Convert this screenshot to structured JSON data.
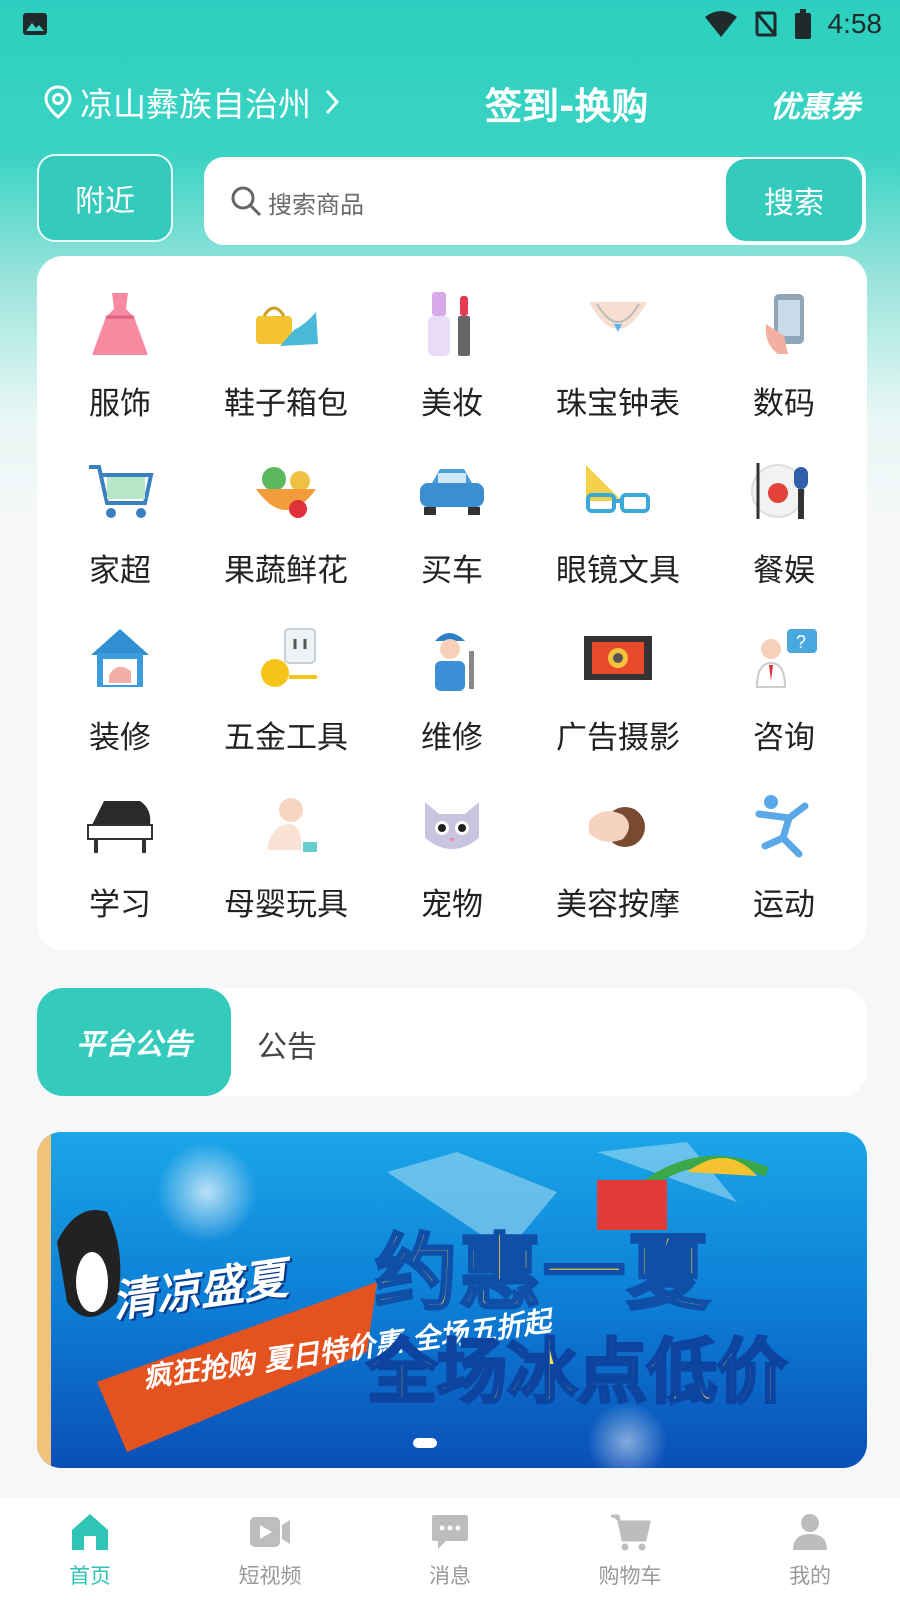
{
  "status_bar": {
    "time": "4:58"
  },
  "header": {
    "location": "凉山彝族自治州",
    "title": "签到-换购",
    "coupon": "优惠券"
  },
  "search": {
    "nearby_label": "附近",
    "placeholder": "搜索商品",
    "button_label": "搜索"
  },
  "categories": [
    {
      "label": "服饰",
      "icon": "dress-icon"
    },
    {
      "label": "鞋子箱包",
      "icon": "shoe-bag-icon"
    },
    {
      "label": "美妆",
      "icon": "makeup-icon"
    },
    {
      "label": "珠宝钟表",
      "icon": "necklace-icon"
    },
    {
      "label": "数码",
      "icon": "phone-icon"
    },
    {
      "label": "家超",
      "icon": "cart-icon"
    },
    {
      "label": "果蔬鲜花",
      "icon": "fruit-bowl-icon"
    },
    {
      "label": "买车",
      "icon": "car-icon"
    },
    {
      "label": "眼镜文具",
      "icon": "glasses-icon"
    },
    {
      "label": "餐娱",
      "icon": "dining-mic-icon"
    },
    {
      "label": "装修",
      "icon": "house-icon"
    },
    {
      "label": "五金工具",
      "icon": "tape-socket-icon"
    },
    {
      "label": "维修",
      "icon": "repairman-icon"
    },
    {
      "label": "广告摄影",
      "icon": "camera-film-icon"
    },
    {
      "label": "咨询",
      "icon": "consultant-icon"
    },
    {
      "label": "学习",
      "icon": "piano-icon"
    },
    {
      "label": "母婴玩具",
      "icon": "baby-icon"
    },
    {
      "label": "宠物",
      "icon": "cat-icon"
    },
    {
      "label": "美容按摩",
      "icon": "massage-icon"
    },
    {
      "label": "运动",
      "icon": "runner-icon"
    }
  ],
  "notice": {
    "tag": "平台公告",
    "text": "公告"
  },
  "banner": {
    "line1": "清凉盛夏",
    "line2": "疯狂抢购 夏日特价惠 全场五折起",
    "headline": "约惠一夏",
    "subline": "全场冰点低价"
  },
  "tabbar": [
    {
      "label": "首页",
      "icon": "home-icon",
      "active": true
    },
    {
      "label": "短视频",
      "icon": "video-icon",
      "active": false
    },
    {
      "label": "消息",
      "icon": "message-icon",
      "active": false
    },
    {
      "label": "购物车",
      "icon": "cart-icon",
      "active": false
    },
    {
      "label": "我的",
      "icon": "profile-icon",
      "active": false
    }
  ],
  "colors": {
    "accent": "#34cbbd",
    "active_tab": "#2fc5b6",
    "inactive_tab": "#9a9a9a"
  }
}
